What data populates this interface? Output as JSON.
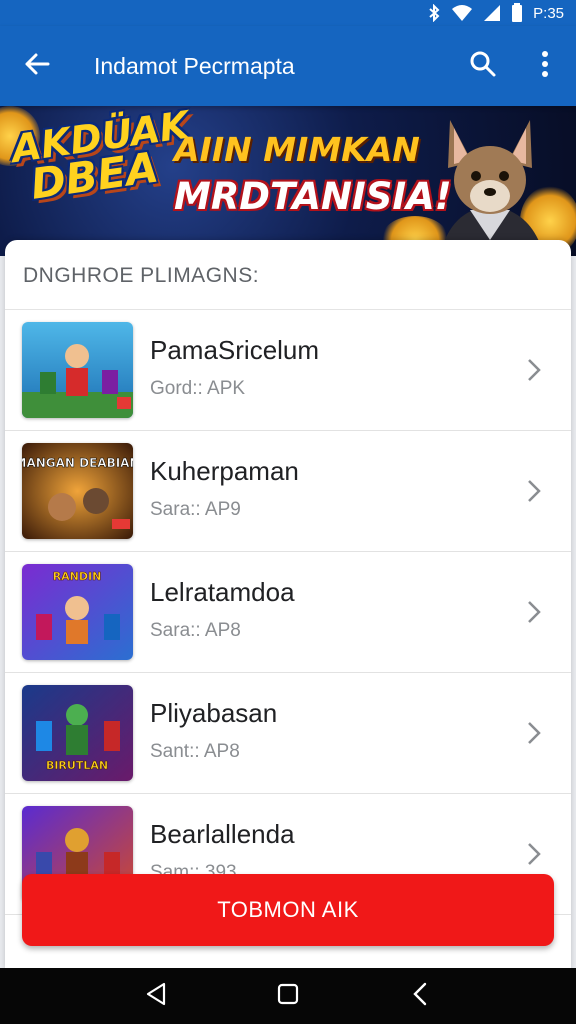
{
  "status_bar": {
    "time": "P:35",
    "icons": [
      "bluetooth-icon",
      "wifi-icon",
      "signal-icon",
      "battery-icon"
    ]
  },
  "app_bar": {
    "title": "Indamot Pecrmapta",
    "icons": [
      "back-arrow-icon",
      "search-icon",
      "more-vert-icon"
    ]
  },
  "banner": {
    "logo_line1": "AKDÜAK",
    "logo_line2": "DBEA",
    "headline_line1": "AIIN MIMKAN",
    "headline_line2": "MRDTANISIA!"
  },
  "section": {
    "header": "DNGHROE PLIMAGNS:"
  },
  "items": [
    {
      "name": "PamaSricelum",
      "sub": "Gord:: APK"
    },
    {
      "name": "Kuherpaman",
      "sub": "Sara:: AP9"
    },
    {
      "name": "Lelratamdoa",
      "sub": "Sara:: AP8"
    },
    {
      "name": "Pliyabasan",
      "sub": "Sant:: AP8"
    },
    {
      "name": "Bearlallenda",
      "sub": "Sam:: 393"
    }
  ],
  "thumb_texts": [
    "",
    "MANGAN DEABIAN",
    "RANDIN",
    "BIRUTLAN",
    ""
  ],
  "cta": {
    "label": "TOBMON AIK"
  },
  "colors": {
    "primary": "#1565c0",
    "accent": "#f01818",
    "nav": "#060606"
  }
}
